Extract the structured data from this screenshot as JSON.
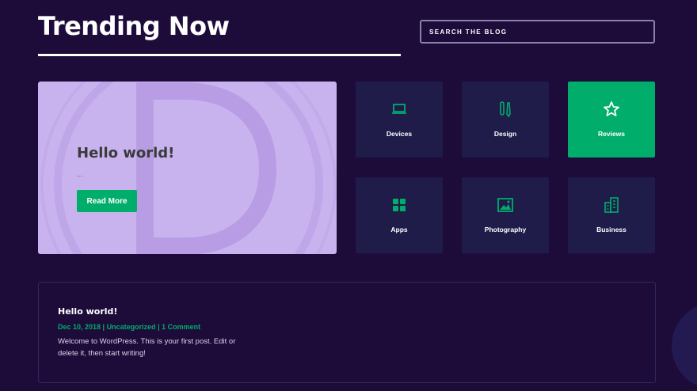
{
  "header": {
    "title": "Trending Now",
    "search_placeholder": "SEARCH THE BLOG"
  },
  "hero": {
    "title": "Hello world!",
    "excerpt": "...",
    "button_label": "Read More"
  },
  "categories": [
    {
      "label": "Devices",
      "icon": "laptop-icon",
      "active": false
    },
    {
      "label": "Design",
      "icon": "pencils-icon",
      "active": false
    },
    {
      "label": "Reviews",
      "icon": "star-icon",
      "active": true
    },
    {
      "label": "Apps",
      "icon": "grid-icon",
      "active": false
    },
    {
      "label": "Photography",
      "icon": "image-icon",
      "active": false
    },
    {
      "label": "Business",
      "icon": "buildings-icon",
      "active": false
    }
  ],
  "post": {
    "title": "Hello world!",
    "date": "Dec 10, 2018",
    "category": "Uncategorized",
    "comments": "1 Comment",
    "separator": " | ",
    "excerpt": "Welcome to WordPress. This is your first post. Edit or delete it, then start writing!"
  },
  "colors": {
    "background": "#1d0b3a",
    "tile": "#1f1c4a",
    "accent": "#00ad6b",
    "hero": "#c9b3ef"
  }
}
